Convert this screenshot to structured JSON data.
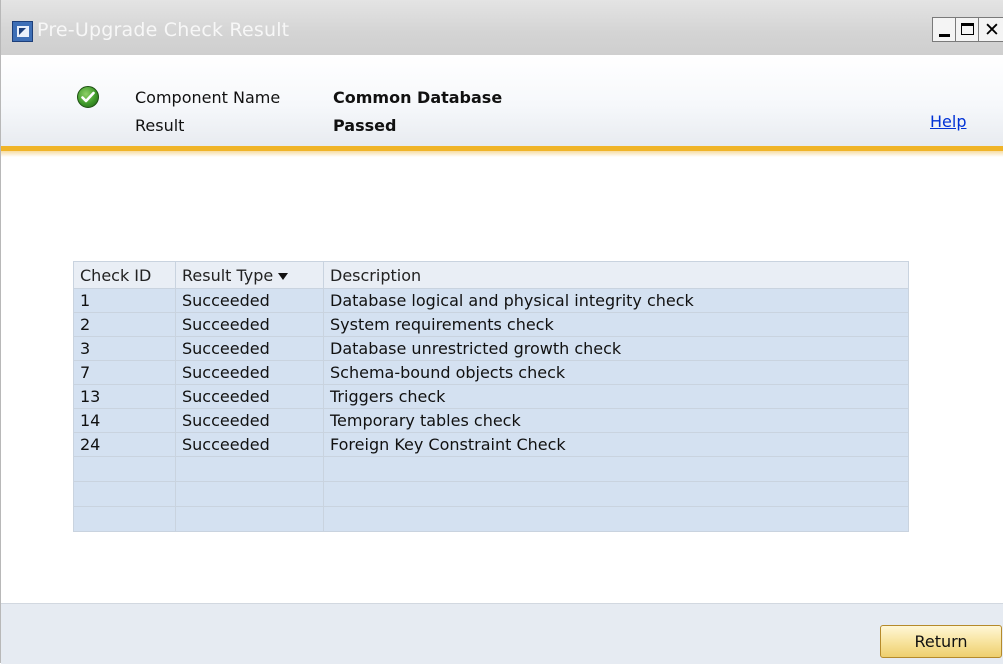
{
  "window": {
    "title": "Pre-Upgrade Check Result"
  },
  "header": {
    "component_label": "Component Name",
    "component_value": "Common Database",
    "result_label": "Result",
    "result_value": "Passed",
    "help_link": "Help",
    "status_icon": "check-circle-green"
  },
  "table": {
    "columns": [
      "Check ID",
      "Result Type",
      "Description"
    ],
    "rows": [
      {
        "id": "1",
        "type": "Succeeded",
        "desc": "Database logical and physical integrity check"
      },
      {
        "id": "2",
        "type": "Succeeded",
        "desc": "System requirements check"
      },
      {
        "id": "3",
        "type": "Succeeded",
        "desc": "Database unrestricted growth check"
      },
      {
        "id": "7",
        "type": "Succeeded",
        "desc": "Schema-bound objects check"
      },
      {
        "id": "13",
        "type": "Succeeded",
        "desc": "Triggers check"
      },
      {
        "id": "14",
        "type": "Succeeded",
        "desc": "Temporary tables check"
      },
      {
        "id": "24",
        "type": "Succeeded",
        "desc": "Foreign Key Constraint Check"
      }
    ]
  },
  "footer": {
    "return_label": "Return"
  },
  "colors": {
    "accent": "#f0b428",
    "row_bg": "#d4e1f1",
    "link": "#0031d6"
  }
}
